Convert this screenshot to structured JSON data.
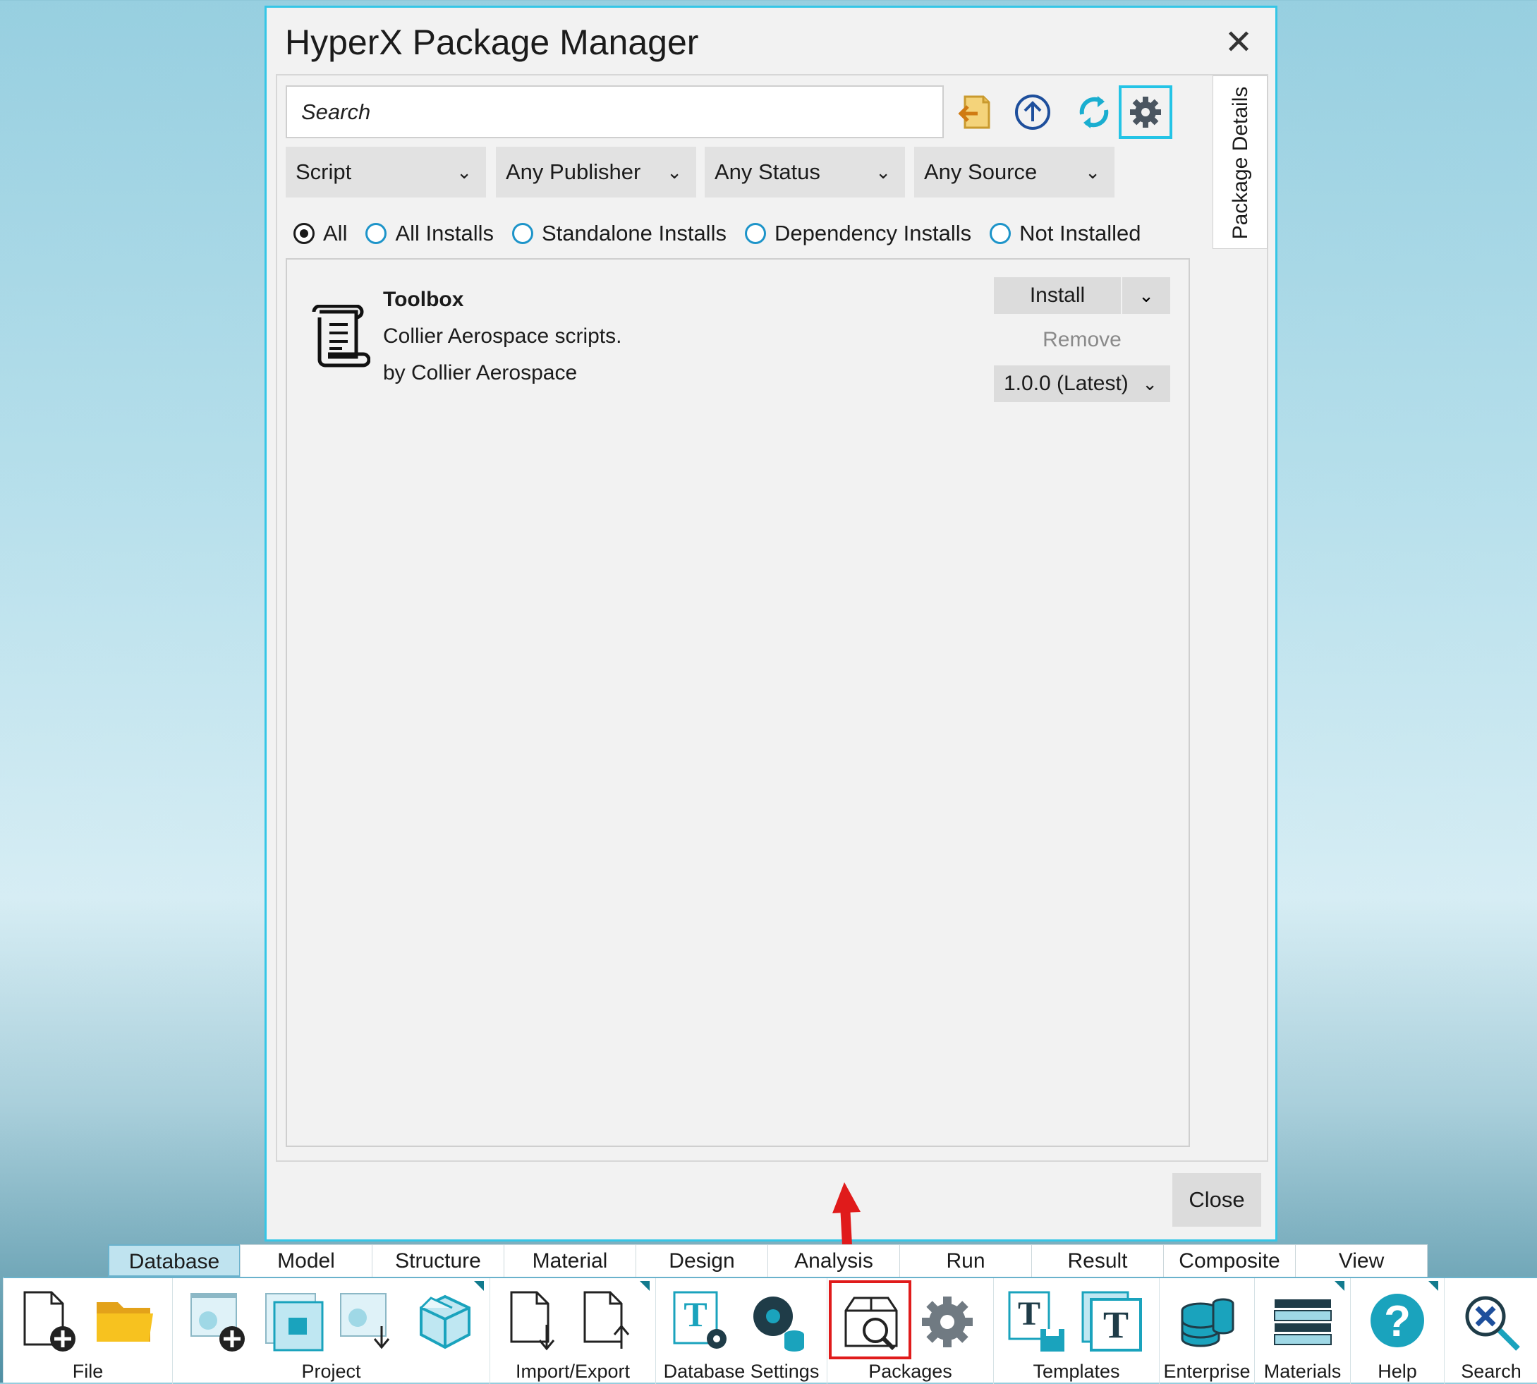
{
  "dialog": {
    "title": "HyperX Package Manager",
    "close_glyph": "✕",
    "side_tab": "Package Details",
    "search": {
      "placeholder": "Search",
      "value": ""
    },
    "toolbar": [
      {
        "icon": "import-package-icon"
      },
      {
        "icon": "upload-icon"
      },
      {
        "icon": "refresh-icon"
      },
      {
        "icon": "settings-icon",
        "selected": true
      }
    ],
    "filters": [
      {
        "value": "Script"
      },
      {
        "value": "Any Publisher"
      },
      {
        "value": "Any Status"
      },
      {
        "value": "Any Source"
      }
    ],
    "radios": [
      {
        "label": "All",
        "checked": true
      },
      {
        "label": "All Installs",
        "checked": false
      },
      {
        "label": "Standalone Installs",
        "checked": false
      },
      {
        "label": "Dependency Installs",
        "checked": false
      },
      {
        "label": "Not Installed",
        "checked": false
      }
    ],
    "package": {
      "icon": "scroll-icon",
      "name": "Toolbox",
      "description": "Collier Aerospace scripts.",
      "publisher": "by Collier Aerospace",
      "install_label": "Install",
      "remove_label": "Remove",
      "version": "1.0.0 (Latest)"
    },
    "close_button": "Close"
  },
  "ribbon": {
    "tabs": [
      "Database",
      "Model",
      "Structure",
      "Material",
      "Design",
      "Analysis",
      "Run",
      "Result",
      "Composite",
      "View"
    ],
    "active_tab": "Database",
    "groups": [
      {
        "label": "File",
        "icons": [
          "new-file-icon",
          "open-folder-icon"
        ]
      },
      {
        "label": "Project",
        "icons": [
          "new-project-icon",
          "project-window-icon",
          "project-import-icon",
          "package-box-icon"
        ]
      },
      {
        "label": "Import/Export",
        "icons": [
          "import-icon",
          "export-icon"
        ]
      },
      {
        "label": "Database Settings",
        "icons": [
          "template-settings-icon",
          "database-gear-icon"
        ]
      },
      {
        "label": "Packages",
        "icons": [
          "package-search-icon",
          "package-settings-icon"
        ]
      },
      {
        "label": "Templates",
        "icons": [
          "template-save-icon",
          "template-icon"
        ]
      },
      {
        "label": "Enterprise",
        "icons": [
          "enterprise-database-icon"
        ]
      },
      {
        "label": "Materials",
        "icons": [
          "materials-icon"
        ]
      },
      {
        "label": "Help",
        "icons": [
          "help-icon"
        ]
      },
      {
        "label": "Search",
        "icons": [
          "search-icon"
        ]
      }
    ]
  },
  "colors": {
    "accent": "#35c6e6",
    "highlight": "#e01b1b",
    "ribbon_icon": "#1aa3bd",
    "active_tab": "#bfe3ef"
  }
}
